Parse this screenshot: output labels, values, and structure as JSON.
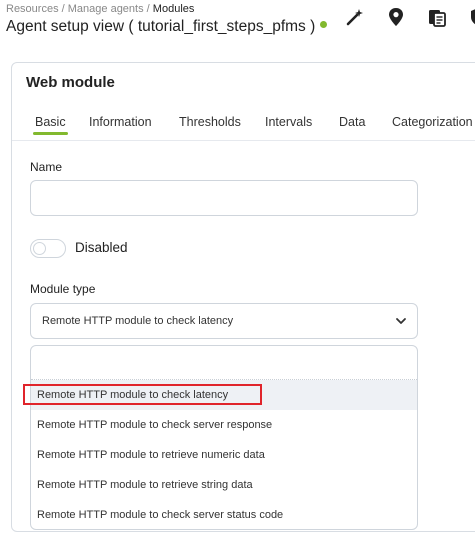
{
  "breadcrumb": {
    "items": [
      "Resources",
      "Manage agents"
    ],
    "separator": "/",
    "current": "Modules"
  },
  "page": {
    "title": "Agent setup view ( tutorial_first_steps_pfms )",
    "status_color": "#82b92e"
  },
  "toolbar": {
    "icons": [
      "wand-icon",
      "map-pin-icon",
      "copy-icon",
      "shield-icon"
    ]
  },
  "card": {
    "title": "Web module",
    "tabs": [
      {
        "label": "Basic",
        "active": true
      },
      {
        "label": "Information",
        "active": false
      },
      {
        "label": "Thresholds",
        "active": false
      },
      {
        "label": "Intervals",
        "active": false
      },
      {
        "label": "Data",
        "active": false
      },
      {
        "label": "Categorization",
        "active": false
      }
    ],
    "accent": "#82b92e"
  },
  "form": {
    "name_label": "Name",
    "name_value": "",
    "disabled_label": "Disabled",
    "disabled_on": false,
    "module_type_label": "Module type",
    "module_type_selected": "Remote HTTP module to check latency",
    "dropdown_search_value": "",
    "options": [
      "Remote HTTP module to check latency",
      "Remote HTTP module to check server response",
      "Remote HTTP module to retrieve numeric data",
      "Remote HTTP module to retrieve string data",
      "Remote HTTP module to check server status code"
    ],
    "highlighted_option_index": 0,
    "highlight_color": "#e0242b"
  }
}
